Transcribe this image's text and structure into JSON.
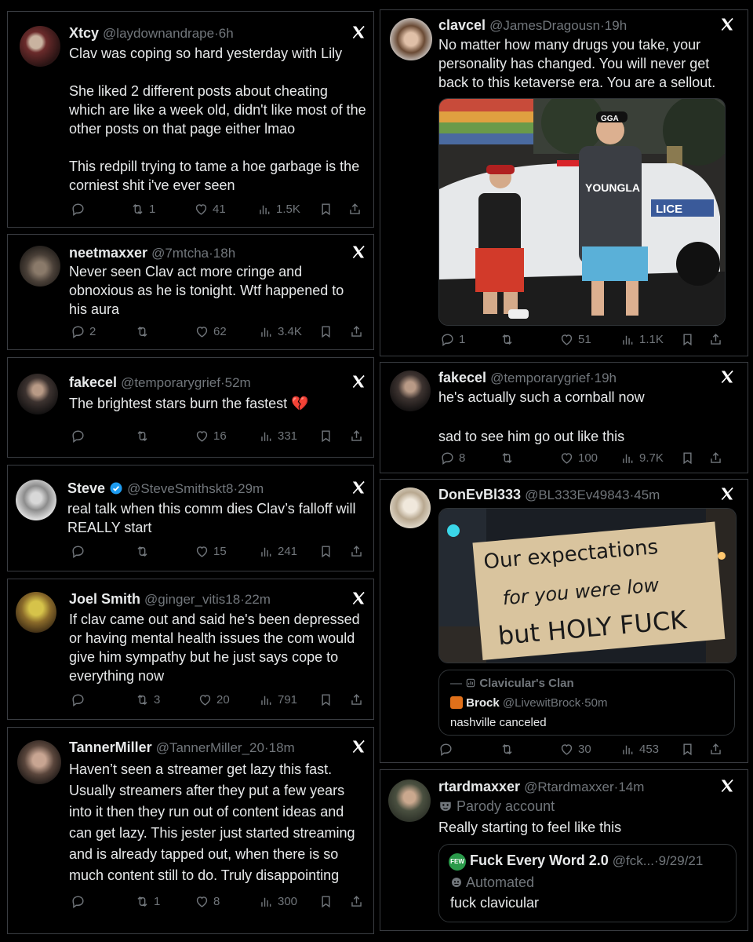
{
  "tweets": {
    "t1": {
      "name": "Xtcy",
      "handle": "@laydownandrape",
      "time": "6h",
      "text": "Clav was coping so hard yesterday with Lily\n\nShe liked 2 different posts about cheating which are like a week old, didn't like most of the other posts on that page either lmao\n\nThis redpill trying to tame a hoe garbage is the corniest shit i've ever seen",
      "replies": "",
      "reposts": "1",
      "likes": "41",
      "views": "1.5K"
    },
    "t2": {
      "name": "neetmaxxer",
      "handle": "@7mtcha",
      "time": "18h",
      "text": "Never seen Clav act more cringe and obnoxious as he is tonight. Wtf happened to his aura",
      "replies": "2",
      "reposts": "",
      "likes": "62",
      "views": "3.4K"
    },
    "t3": {
      "name": "fakecel",
      "handle": "@temporarygrief",
      "time": "52m",
      "text": "The brightest stars burn the fastest 💔",
      "replies": "",
      "reposts": "",
      "likes": "16",
      "views": "331"
    },
    "t4": {
      "name": "Steve",
      "handle": "@SteveSmithskt8",
      "time": "29m",
      "text": "real talk when this comm dies Clav’s falloff will REALLY start",
      "replies": "",
      "reposts": "",
      "likes": "15",
      "views": "241"
    },
    "t5": {
      "name": "Joel Smith",
      "handle": "@ginger_vitis18",
      "time": "22m",
      "text": "If clav came out and said he's been depressed or having mental health issues the com would give him sympathy but he just says cope to everything now",
      "replies": "",
      "reposts": "3",
      "likes": "20",
      "views": "791"
    },
    "t6": {
      "name": "TannerMiller",
      "handle": "@TannerMiller_20",
      "time": "18m",
      "text": "Haven’t seen a streamer get lazy this fast. Usually streamers after they put a few years into it then they run out of content ideas and can get lazy. This jester just started streaming and is already tapped out, when there is so much content still to do. Truly disappointing",
      "replies": "",
      "reposts": "1",
      "likes": "8",
      "views": "300"
    },
    "t7": {
      "name": "clavcel",
      "handle": "@JamesDragousn",
      "time": "19h",
      "text": "No matter how many drugs you take, your personality has changed. You will never get back to this ketaverse era. You are a sellout.",
      "replies": "1",
      "reposts": "",
      "likes": "51",
      "views": "1.1K",
      "photo_shirt": "YOUNGLA",
      "photo_cap": "GGA",
      "photo_car": "LICE"
    },
    "t8": {
      "name": "fakecel",
      "handle": "@temporarygrief",
      "time": "19h",
      "text": "he's actually such a cornball now\n\nsad to see him go out like this",
      "replies": "8",
      "reposts": "",
      "likes": "100",
      "views": "9.7K"
    },
    "t9": {
      "name": "DonEvBl333",
      "handle": "@BL333Ev49843",
      "time": "45m",
      "sign_line1": "Our expectations",
      "sign_line2": "for you were low",
      "sign_line3": "but HOLY FUCK",
      "community": "Clavicular's Clan",
      "quote_name": "Brock",
      "quote_handle": "@LivewitBrock",
      "quote_time": "50m",
      "quote_text": "nashville canceled",
      "replies": "",
      "reposts": "",
      "likes": "30",
      "views": "453"
    },
    "t10": {
      "name": "rtardmaxxer",
      "handle": "@Rtardmaxxer",
      "time": "14m",
      "label": "Parody account",
      "text": "Really starting to feel like this",
      "quote_name": "Fuck Every Word 2.0",
      "quote_handle": "@fck...",
      "quote_time": "9/29/21",
      "quote_logo": "FEW",
      "quote_label": "Automated",
      "quote_text": "fuck clavicular"
    }
  },
  "sep": "·",
  "colors": {
    "bg": "#000000",
    "border": "#3a3d42",
    "text": "#e7e9ea",
    "muted": "#71767b",
    "verified": "#1d9bf0",
    "heart": "#f91880"
  }
}
